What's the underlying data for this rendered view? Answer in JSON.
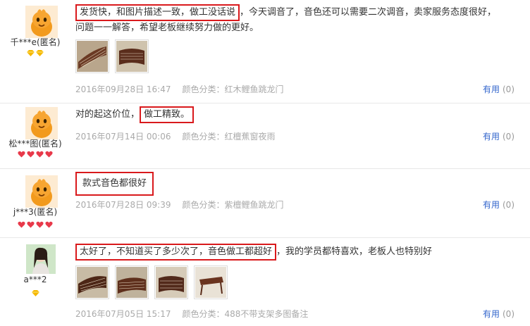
{
  "reviews": [
    {
      "user": "千***e(匿名)",
      "text_highlight": "发货快，和图片描述一致，做工没话说",
      "text_rest_line1": "，今天调音了，音色还可以需要二次调音，卖家服务态度很好，",
      "text_line2": "问题一一解答，希望老板继续努力做的更好。",
      "date": "2016年09月28日 16:47",
      "color_label": "颜色分类：红木鲤鱼跳龙门",
      "useful_label": "有用",
      "useful_count": "(0)"
    },
    {
      "user": "松***图(匿名)",
      "text_before": "对的起这价位，",
      "text_highlight": "做工精致。",
      "date": "2016年07月14日 00:06",
      "color_label": "颜色分类：红檀蕉窗夜雨",
      "useful_label": "有用",
      "useful_count": "(0)"
    },
    {
      "user": "j***3(匿名)",
      "text_highlight": "款式音色都很好",
      "date": "2016年07月28日 09:39",
      "color_label": "颜色分类：紫檀鲤鱼跳龙门",
      "useful_label": "有用",
      "useful_count": "(0)"
    },
    {
      "user": "a***2",
      "text_highlight": "太好了，不知道买了多少次了，音色做工都超好",
      "text_rest": "，我的学员都特喜欢，老板人也特别好",
      "date": "2016年07月05日 15:17",
      "color_label": "颜色分类：488不带支架多图备注",
      "useful_label": "有用",
      "useful_count": "(0)"
    }
  ],
  "colors": {
    "highlight_border": "#d9191c",
    "link": "#3366cc",
    "meta": "#aaaaaa",
    "badge_gold": "#f5b800",
    "badge_red": "#e8394a"
  }
}
